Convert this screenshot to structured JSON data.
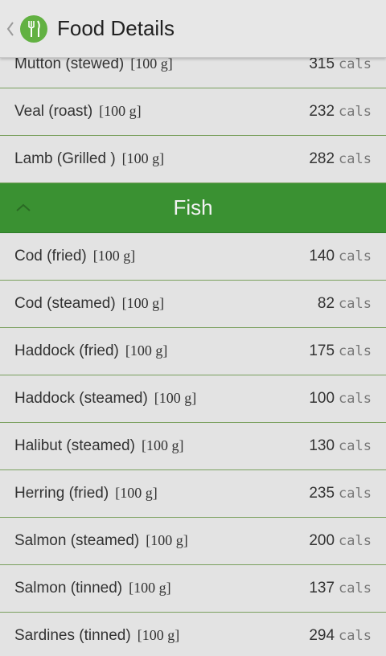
{
  "app": {
    "title": "Food Details",
    "icons": {
      "back": "back-chevron-icon",
      "logo": "fork-knife-icon",
      "collapse": "chevron-up-icon"
    },
    "colors": {
      "section_header": "#3a9132",
      "logo": "#62b142",
      "divider": "#7aa05e"
    }
  },
  "list": {
    "items_before": [
      {
        "name": "Mutton (stewed)",
        "portion": "[100 g]",
        "calories": "315",
        "unit": "cals"
      },
      {
        "name": "Veal (roast)",
        "portion": "[100 g]",
        "calories": "232",
        "unit": "cals"
      },
      {
        "name": "Lamb (Grilled )",
        "portion": "[100 g]",
        "calories": "282",
        "unit": "cals"
      }
    ],
    "section": {
      "title": "Fish"
    },
    "items": [
      {
        "name": "Cod (fried)",
        "portion": "[100 g]",
        "calories": "140",
        "unit": "cals"
      },
      {
        "name": "Cod (steamed)",
        "portion": "[100 g]",
        "calories": "82",
        "unit": "cals"
      },
      {
        "name": "Haddock (fried)",
        "portion": "[100 g]",
        "calories": "175",
        "unit": "cals"
      },
      {
        "name": "Haddock (steamed)",
        "portion": "[100 g]",
        "calories": "100",
        "unit": "cals"
      },
      {
        "name": "Halibut (steamed)",
        "portion": "[100 g]",
        "calories": "130",
        "unit": "cals"
      },
      {
        "name": "Herring (fried)",
        "portion": "[100 g]",
        "calories": "235",
        "unit": "cals"
      },
      {
        "name": "Salmon (steamed)",
        "portion": "[100 g]",
        "calories": "200",
        "unit": "cals"
      },
      {
        "name": "Salmon (tinned)",
        "portion": "[100 g]",
        "calories": "137",
        "unit": "cals"
      },
      {
        "name": "Sardines (tinned)",
        "portion": "[100 g]",
        "calories": "294",
        "unit": "cals"
      }
    ]
  }
}
